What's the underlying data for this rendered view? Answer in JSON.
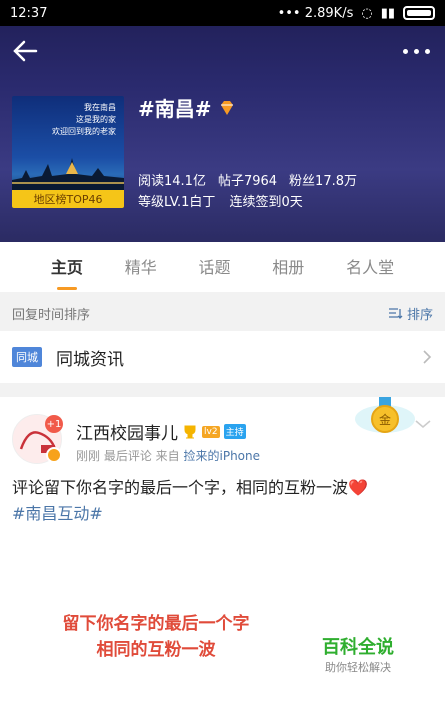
{
  "status_bar": {
    "time": "12:37",
    "network_speed": "2.89K/s"
  },
  "topic": {
    "title": "#南昌#",
    "cover_lines": [
      "我在南昌",
      "这是我的家",
      "欢迎回到我的老家"
    ],
    "rank_label": "地区榜TOP46",
    "stats": {
      "reads": "阅读14.1亿",
      "posts": "帖子7964",
      "fans": "粉丝17.8万"
    },
    "level": "等级LV.1白丁",
    "checkin": "连续签到0天"
  },
  "tabs": [
    "主页",
    "精华",
    "话题",
    "相册",
    "名人堂"
  ],
  "sort": {
    "label": "回复时间排序",
    "button": "排序"
  },
  "city_news": {
    "tag": "同城",
    "title": "同城资讯"
  },
  "post": {
    "author": "江西校园事儿",
    "badge_level": "lv2",
    "badge_host": "主持",
    "avatar_badge": "+1",
    "meta_time": "刚刚 最后评论",
    "meta_from": "来自",
    "meta_source": "捡来的iPhone",
    "medal_label": "金",
    "text": "评论留下你名字的最后一个字，相同的互粉一波❤️",
    "hashtag": "#南昌互动#",
    "image_text_line1": "留下你名字的最后一个字",
    "image_text_line2": "相同的互粉一波",
    "brand_title": "百科全说",
    "brand_sub": "助你轻松解决"
  },
  "colors": {
    "accent": "#f79a23",
    "link": "#4b76a8",
    "hero": "#2a2a6e"
  }
}
